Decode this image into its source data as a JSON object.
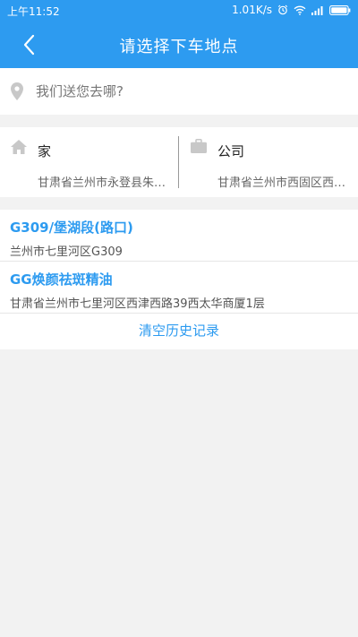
{
  "status_bar": {
    "time": "上午11:52",
    "speed": "1.01K/s",
    "icons": [
      "alarm-icon",
      "wifi-icon",
      "signal-icon",
      "battery-icon"
    ]
  },
  "header": {
    "title": "请选择下车地点",
    "back_icon": "back-arrow-icon"
  },
  "search": {
    "placeholder": "我们送您去哪?",
    "value": ""
  },
  "shortcuts": {
    "home": {
      "label": "家",
      "address": "甘肃省兰州市永登县朱家营"
    },
    "work": {
      "label": "公司",
      "address": "甘肃省兰州市西固区西固中路"
    }
  },
  "history": {
    "items": [
      {
        "title": "G309/堡湖段(路口)",
        "address": "兰州市七里河区G309"
      },
      {
        "title": "GG焕颜祛斑精油",
        "address": "甘肃省兰州市七里河区西津西路39西太华商厦1层"
      }
    ],
    "clear_label": "清空历史记录"
  },
  "colors": {
    "accent": "#2d9bf0",
    "background": "#f2f2f2"
  }
}
